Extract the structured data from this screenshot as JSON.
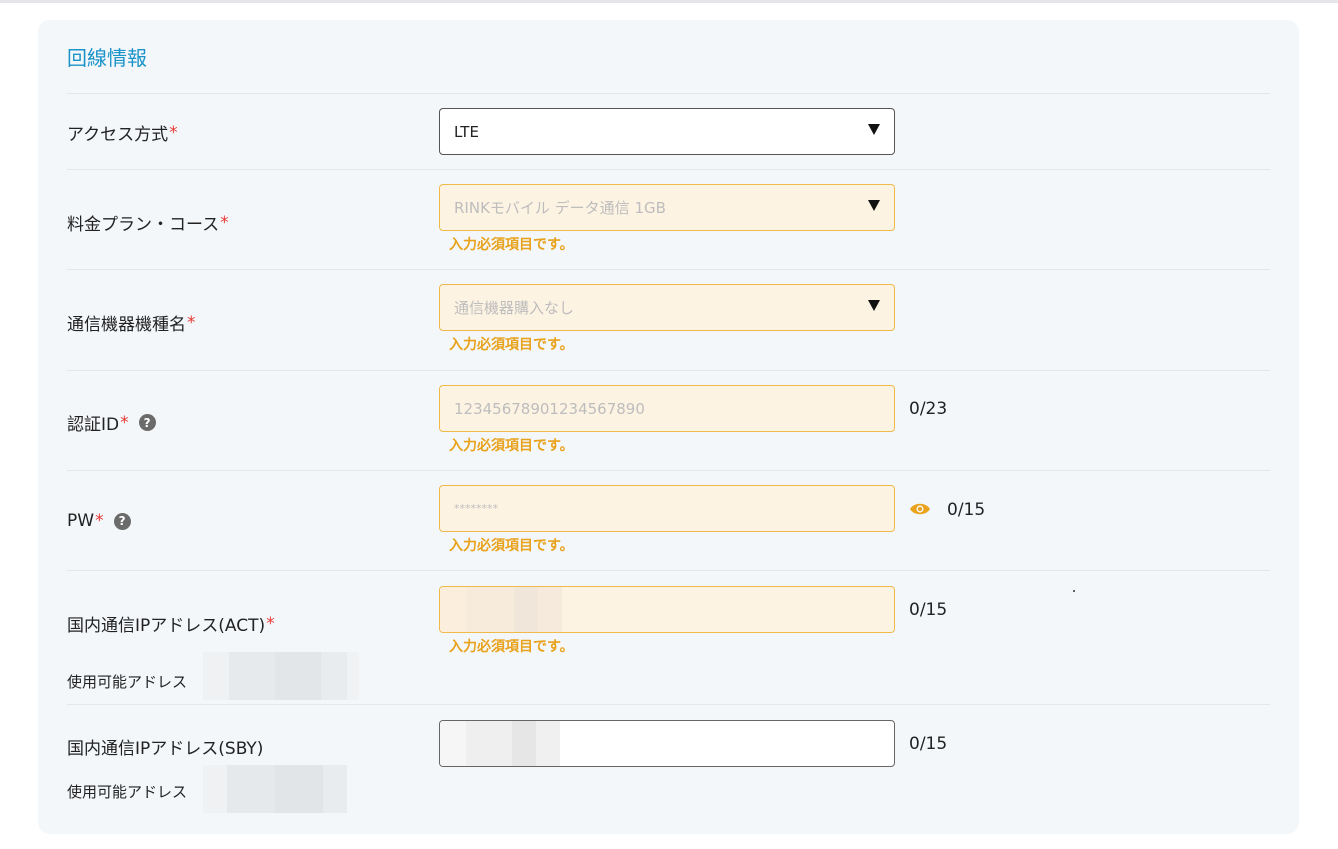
{
  "section": {
    "title": "回線情報"
  },
  "rows": [
    {
      "label": "アクセス方式",
      "required_mark": "*",
      "value": "LTE"
    },
    {
      "label": "料金プラン・コース",
      "required_mark": "*",
      "placeholder": "RINKモバイル データ通信 1GB",
      "error": "入力必須項目です。"
    },
    {
      "label": "通信機器機種名",
      "required_mark": "*",
      "placeholder": "通信機器購入なし",
      "error": "入力必須項目です。"
    },
    {
      "label": "認証ID",
      "required_mark": "*",
      "help": "?",
      "placeholder": "12345678901234567890",
      "error": "入力必須項目です。",
      "counter": "0/23"
    },
    {
      "label": "PW",
      "required_mark": "*",
      "help": "?",
      "placeholder": "********",
      "error": "入力必須項目です。",
      "counter": "0/15"
    },
    {
      "label": "国内通信IPアドレス(ACT)",
      "required_mark": "*",
      "sub_label": "使用可能アドレス",
      "error": "入力必須項目です。",
      "counter": "0/15"
    },
    {
      "label": "国内通信IPアドレス(SBY)",
      "sub_label": "使用可能アドレス",
      "counter": "0/15"
    }
  ],
  "icons": {
    "help": "question-circle-icon",
    "eye": "eye-icon",
    "dropdown": "caret-down-icon"
  },
  "colors": {
    "title": "#1a93c9",
    "error": "#e8a21c",
    "required": "#e53935",
    "error_bg": "#fdf3e3",
    "error_border": "#f1b94a"
  }
}
